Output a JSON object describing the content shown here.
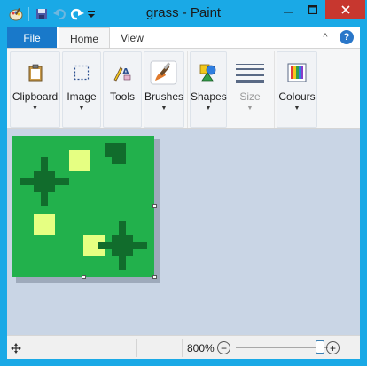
{
  "app": {
    "title": "grass - Paint"
  },
  "titlebar": {
    "minimize_glyph": "—",
    "maximize_glyph": "☐",
    "close_glyph": "✕"
  },
  "tabs": [
    {
      "label": "File"
    },
    {
      "label": "Home"
    },
    {
      "label": "View"
    }
  ],
  "ribbon": {
    "groups": [
      {
        "label": "Clipboard",
        "icon": "clipboard-icon"
      },
      {
        "label": "Image",
        "icon": "select-icon"
      },
      {
        "label": "Tools",
        "icon": "tools-icon"
      },
      {
        "label": "Brushes",
        "icon": "brush-icon"
      },
      {
        "label": "Shapes",
        "icon": "shapes-icon"
      },
      {
        "label": "Size",
        "icon": "size-icon",
        "disabled": true
      },
      {
        "label": "Colours",
        "icon": "colours-icon"
      }
    ],
    "dropdown_glyph": "▼",
    "help_glyph": "?",
    "collapse_glyph": "^"
  },
  "canvas": {
    "background_color": "#22b14c",
    "dark_color": "#116c2c",
    "light_color": "#e6ff82"
  },
  "status": {
    "zoom_value": "800%",
    "zoom_out_glyph": "−",
    "zoom_in_glyph": "+",
    "zoom_slider_position": 0.91
  }
}
